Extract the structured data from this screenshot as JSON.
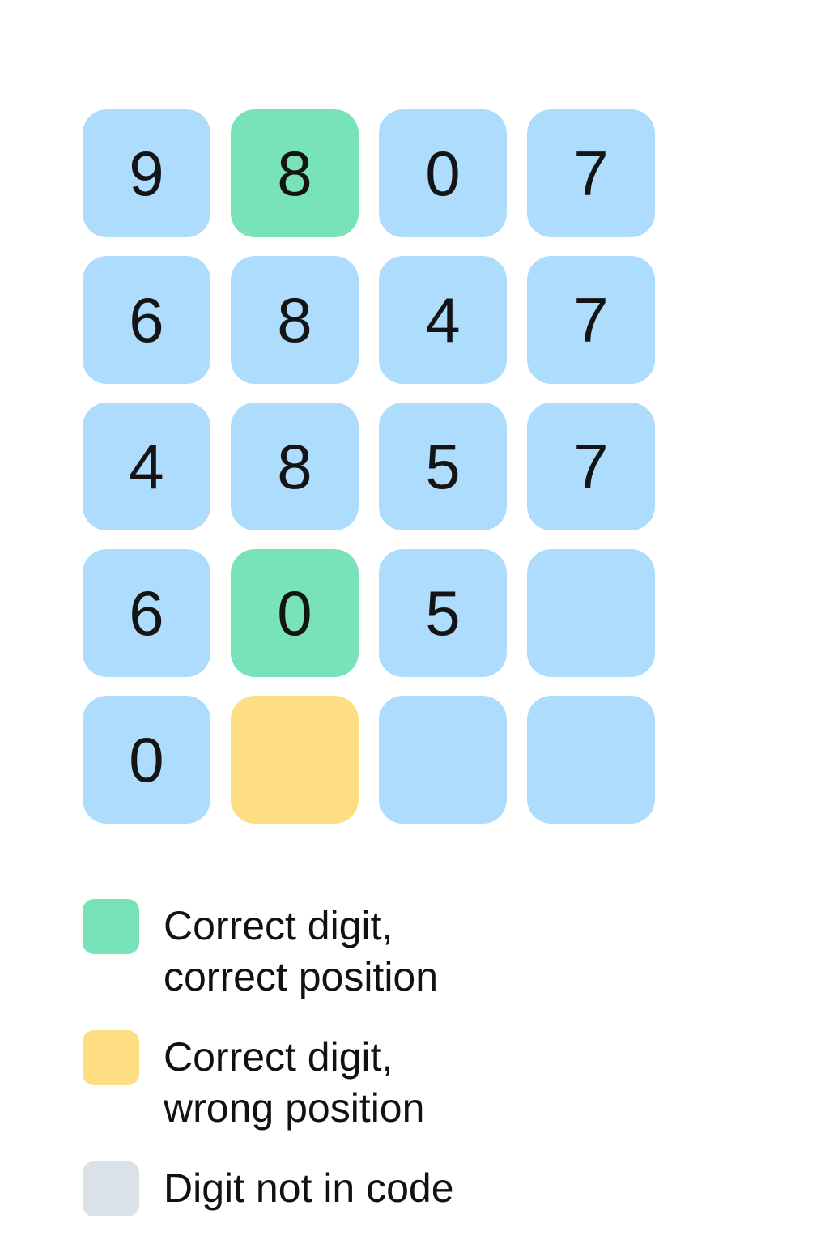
{
  "colors": {
    "absent": "#addcfd",
    "correct": "#78e3b8",
    "present": "#fdde82",
    "not_in_code": "#dbe1e9"
  },
  "grid": [
    [
      {
        "digit": "9",
        "state": "absent"
      },
      {
        "digit": "8",
        "state": "correct"
      },
      {
        "digit": "0",
        "state": "absent"
      },
      {
        "digit": "7",
        "state": "absent"
      }
    ],
    [
      {
        "digit": "6",
        "state": "absent"
      },
      {
        "digit": "8",
        "state": "absent"
      },
      {
        "digit": "4",
        "state": "absent"
      },
      {
        "digit": "7",
        "state": "absent"
      }
    ],
    [
      {
        "digit": "4",
        "state": "absent"
      },
      {
        "digit": "8",
        "state": "absent"
      },
      {
        "digit": "5",
        "state": "absent"
      },
      {
        "digit": "7",
        "state": "absent"
      }
    ],
    [
      {
        "digit": "6",
        "state": "absent"
      },
      {
        "digit": "0",
        "state": "correct"
      },
      {
        "digit": "5",
        "state": "absent"
      },
      {
        "digit": "",
        "state": "absent"
      }
    ],
    [
      {
        "digit": "0",
        "state": "absent"
      },
      {
        "digit": "",
        "state": "present"
      },
      {
        "digit": "",
        "state": "absent"
      },
      {
        "digit": "",
        "state": "absent"
      }
    ]
  ],
  "legend": [
    {
      "label": "Correct digit, correct position",
      "state": "correct"
    },
    {
      "label": "Correct digit, wrong position",
      "state": "present"
    },
    {
      "label": "Digit not in code",
      "state": "not_in_code"
    }
  ]
}
